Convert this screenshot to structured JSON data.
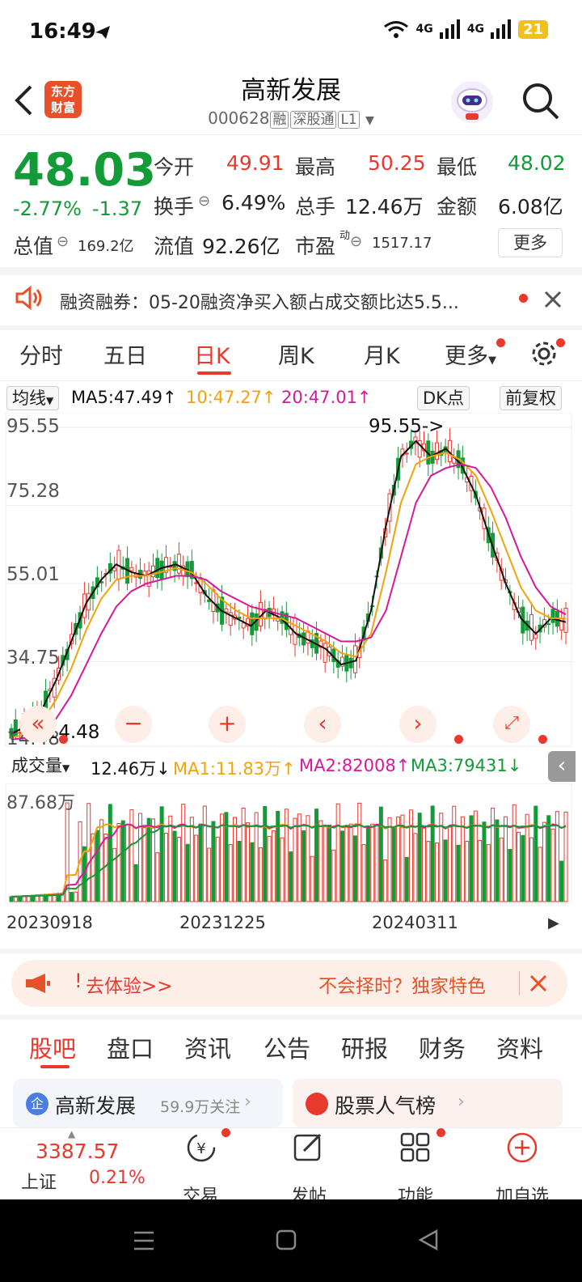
{
  "status": {
    "time": "16:49",
    "battery": "21",
    "net1": "4G",
    "net2": "4G"
  },
  "header": {
    "title": "高新发展",
    "code": "000628",
    "tag_rong": "融",
    "tag_sgt": "深股通",
    "tag_level": "L1",
    "logo_text": "东方财富"
  },
  "quote": {
    "price": "48.03",
    "pct": "-2.77%",
    "chg": "-1.37",
    "open_label": "今开",
    "open": "49.91",
    "high_label": "最高",
    "high": "50.25",
    "low_label": "最低",
    "low": "48.02",
    "turnover_label": "换手",
    "turnover": "6.49%",
    "vol_label": "总手",
    "vol": "12.46万",
    "amount_label": "金额",
    "amount": "6.08亿",
    "mktcap_label": "总值",
    "mktcap": "169.2亿",
    "float_label": "流值",
    "float": "92.26亿",
    "pe_label": "市盈",
    "pe_sup": "动",
    "pe": "1517.17",
    "more": "更多"
  },
  "notice": {
    "text": "融资融券：05-20融资净买入额占成交额比达5.5..."
  },
  "tabs": {
    "t1": "分时",
    "t2": "五日",
    "t3": "日K",
    "t4": "周K",
    "t5": "月K",
    "t6": "更多"
  },
  "ma": {
    "label": "均线",
    "ma5": "MA5:47.49↑",
    "ma10": "10:47.27↑",
    "ma20": "20:47.01↑",
    "dk": "DK点",
    "adj": "前复权"
  },
  "kchart": {
    "y1": "95.55",
    "y2": "75.28",
    "y3": "55.01",
    "y4": "34.75",
    "y5": "14.48",
    "max_label": "95.55->",
    "min_label": "<-14.48"
  },
  "volume": {
    "label": "成交量",
    "value": "12.46万↓",
    "ma1": "MA1:11.83万↑",
    "ma2": "MA2:82008↑",
    "ma3": "MA3:79431↓",
    "max": "87.68万"
  },
  "dates": {
    "d1": "20230918",
    "d2": "20231225",
    "d3": "20240311"
  },
  "promo": {
    "left": "去体验>>",
    "right": "不会择时？独家特色"
  },
  "btabs": {
    "b1": "股吧",
    "b2": "盘口",
    "b3": "资讯",
    "b4": "公告",
    "b5": "研报",
    "b6": "财务",
    "b7": "资料"
  },
  "cards": {
    "c1_name": "高新发展",
    "c1_follow": "59.9万关注",
    "c2_name": "股票人气榜"
  },
  "bottom": {
    "index_value": "3387.57",
    "index_name": "上证",
    "index_pct": "0.21%",
    "trade": "交易",
    "post": "发帖",
    "func": "功能",
    "add": "加自选"
  },
  "colors": {
    "up": "#e8392f",
    "down": "#139b38",
    "ma5": "#111111",
    "ma10": "#f0a30a",
    "ma20": "#d6199a"
  },
  "chart_data": {
    "type": "candlestick",
    "title": "",
    "ylim": [
      14.48,
      95.55
    ],
    "x_ticks": [
      "20230918",
      "20231225",
      "20240311"
    ],
    "series": [
      {
        "name": "MA5",
        "values": [
          16,
          18,
          22,
          30,
          40,
          50,
          56,
          60,
          58,
          57,
          59,
          60,
          58,
          52,
          48,
          46,
          44,
          48,
          46,
          42,
          40,
          38,
          34,
          35,
          48,
          70,
          88,
          92,
          88,
          90,
          86,
          78,
          66,
          55,
          46,
          42,
          46,
          45
        ]
      },
      {
        "name": "MA10",
        "values": [
          15,
          16,
          19,
          25,
          33,
          43,
          51,
          56,
          57,
          57,
          58,
          59,
          58,
          55,
          51,
          48,
          46,
          46,
          46,
          44,
          42,
          40,
          37,
          36,
          42,
          58,
          76,
          86,
          88,
          89,
          87,
          83,
          74,
          64,
          54,
          48,
          46,
          46
        ]
      },
      {
        "name": "MA20",
        "values": [
          14.5,
          15,
          17,
          20,
          26,
          34,
          42,
          49,
          53,
          55,
          56,
          57,
          57,
          56,
          53,
          51,
          49,
          48,
          47,
          46,
          44,
          42,
          40,
          40,
          41,
          48,
          62,
          76,
          83,
          85,
          86,
          85,
          80,
          72,
          62,
          54,
          49,
          47
        ]
      }
    ]
  }
}
